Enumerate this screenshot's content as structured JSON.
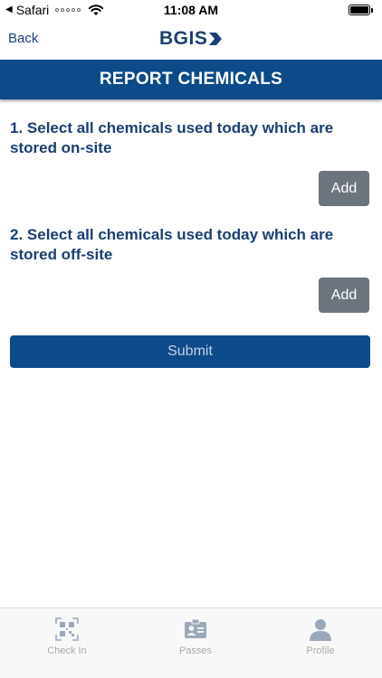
{
  "status_bar": {
    "carrier": "Safari",
    "time": "11:08 AM"
  },
  "nav": {
    "back_label": "Back",
    "logo_text": "BGIS"
  },
  "header": {
    "title": "REPORT CHEMICALS"
  },
  "sections": [
    {
      "title": "1. Select all chemicals used today which are stored on-site",
      "add_label": "Add"
    },
    {
      "title": "2. Select all chemicals used today which are stored off-site",
      "add_label": "Add"
    }
  ],
  "submit_label": "Submit",
  "tabs": [
    {
      "label": "Check In",
      "icon": "qr-code-icon"
    },
    {
      "label": "Passes",
      "icon": "id-card-icon"
    },
    {
      "label": "Profile",
      "icon": "person-icon"
    }
  ],
  "colors": {
    "brand": "#0d4a8a",
    "heading_text": "#1a3f73",
    "add_button": "#6c757d",
    "tab_inactive": "#a9a9a9"
  }
}
